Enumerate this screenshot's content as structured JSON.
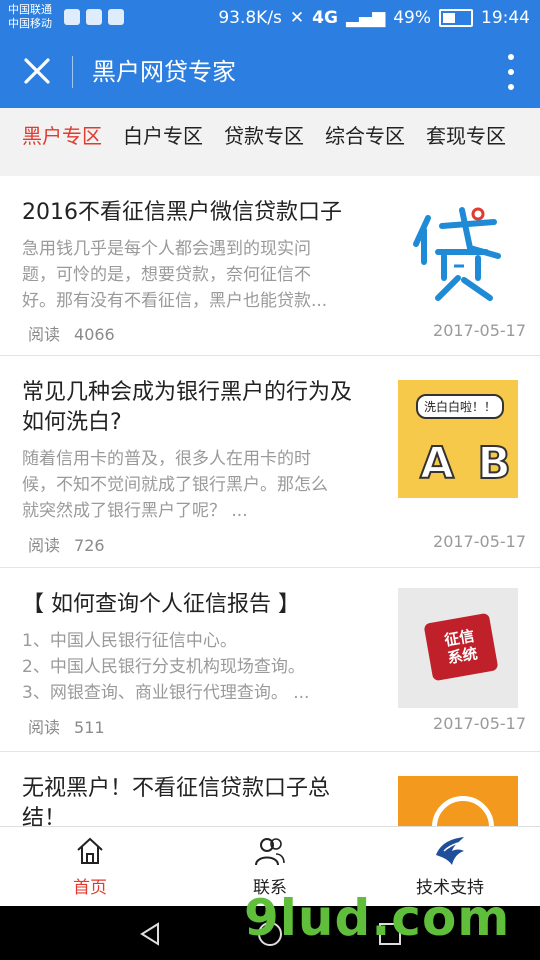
{
  "status_bar": {
    "carrier1": "中国联通",
    "carrier2": "中国移动",
    "speed": "93.8K/s",
    "network": "4G",
    "battery": "49%",
    "time": "19:44"
  },
  "header": {
    "title": "黑户网贷专家"
  },
  "tabs": [
    "黑户专区",
    "白户专区",
    "贷款专区",
    "综合专区",
    "套现专区"
  ],
  "articles": [
    {
      "title": "2016不看征信黑户微信贷款口子",
      "summary": [
        "急用钱几乎是每个人都会遇到的现实问",
        "题，可怜的是，想要贷款，奈何征信不",
        "好。那有没有不看征信，黑户也能贷款..."
      ],
      "reads_label": "阅读",
      "reads": "4066",
      "date": "2017-05-17",
      "thumb_icon": "loan-character-icon"
    },
    {
      "title": [
        "常见几种会成为银行黑户的行为及",
        "如何洗白?"
      ],
      "summary": [
        "随着信用卡的普及，很多人在用卡的时",
        "候，不知不觉间就成了银行黑户。那怎么",
        "就突然成了银行黑户了呢？ ..."
      ],
      "reads_label": "阅读",
      "reads": "726",
      "date": "2017-05-17",
      "thumb_text": "洗白白啦！！",
      "thumb_letters": "A B"
    },
    {
      "title": "【 如何查询个人征信报告 】",
      "summary": [
        "1、中国人民银行征信中心。",
        "2、中国人民银行分支机构现场查询。",
        "3、网银查询、商业银行代理查询。 ..."
      ],
      "reads_label": "阅读",
      "reads": "511",
      "date": "2017-05-17",
      "thumb_text": "征信系统"
    },
    {
      "title": [
        "无视黑户！不看征信贷款口子总",
        "结！"
      ]
    }
  ],
  "bottom_tabs": [
    {
      "label": "首页",
      "icon": "home-icon"
    },
    {
      "label": "联系",
      "icon": "contacts-icon"
    },
    {
      "label": "技术支持",
      "icon": "eagle-logo-icon"
    }
  ],
  "watermark": "9lud.com",
  "colors": {
    "primary": "#2c7fe0",
    "active": "#e23a2e",
    "muted": "#9a9a9a"
  }
}
